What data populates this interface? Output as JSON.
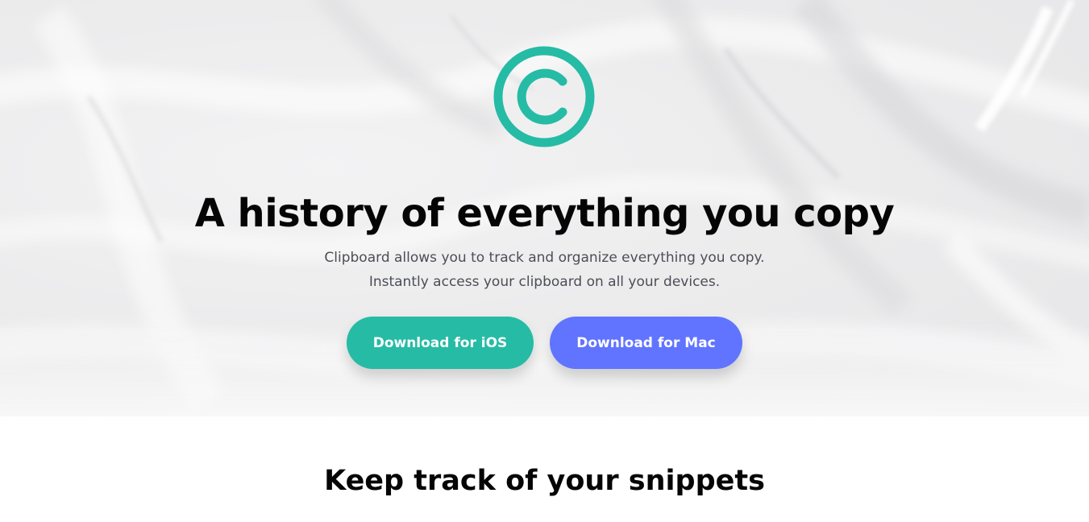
{
  "hero": {
    "logo_icon": "copyright-circle-icon",
    "accent_color": "#26bba5",
    "headline": "A history of everything you copy",
    "subline_1": "Clipboard allows you to track and organize everything you copy.",
    "subline_2": "Instantly access your clipboard on all your devices.",
    "buttons": [
      {
        "label": "Download for iOS",
        "color": "#26bba5"
      },
      {
        "label": "Download for Mac",
        "color": "#6174ff"
      }
    ]
  },
  "features": {
    "title": "Keep track of your snippets"
  }
}
